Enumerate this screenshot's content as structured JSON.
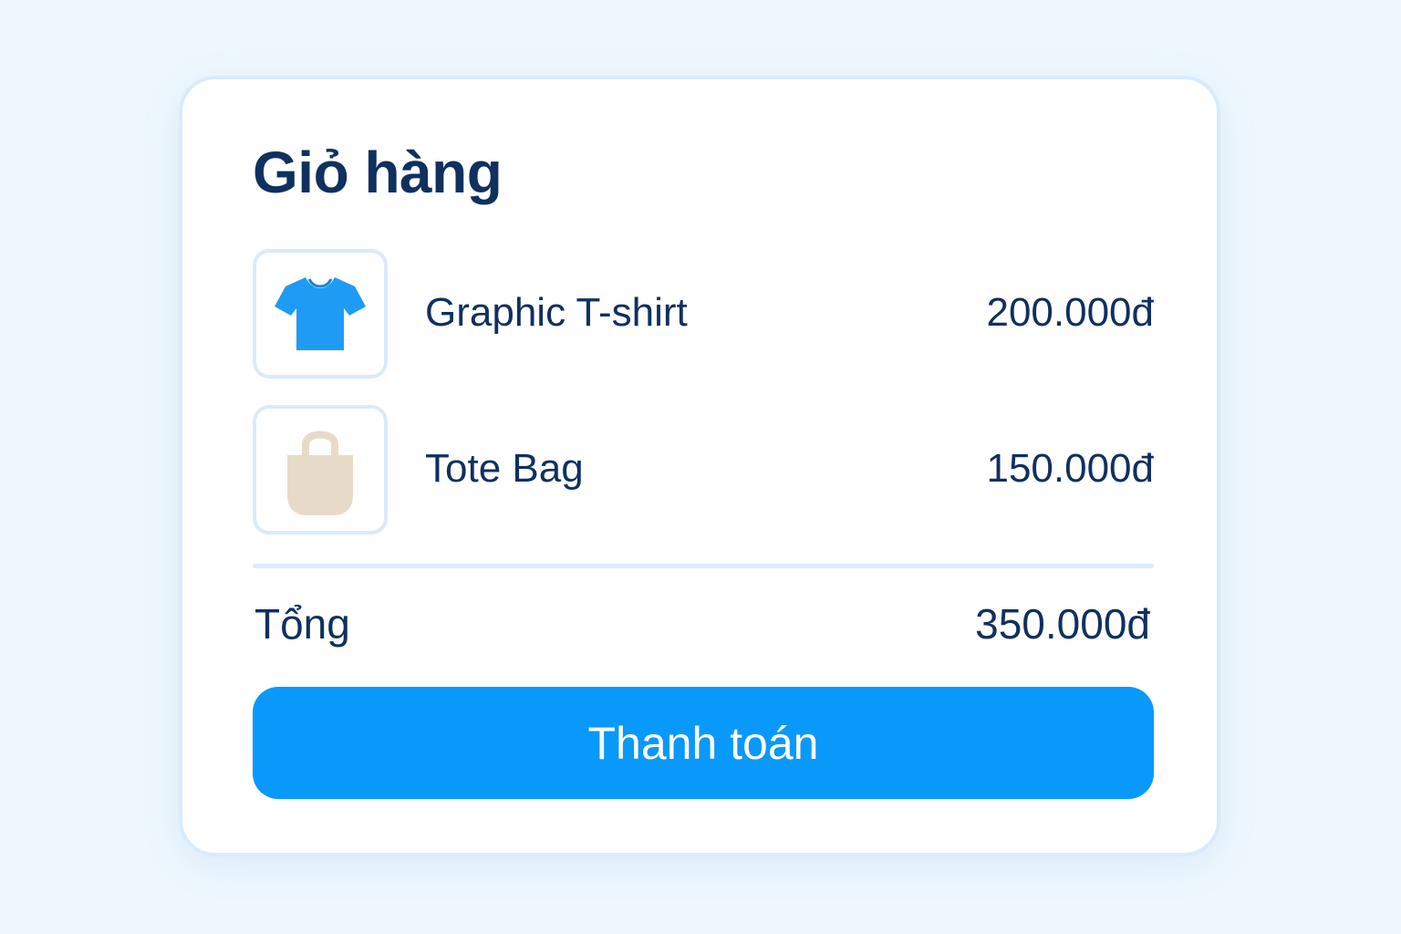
{
  "cart": {
    "title": "Giỏ hàng",
    "items": [
      {
        "name": "Graphic T-shirt",
        "price": "200.000đ",
        "icon": "tshirt-icon",
        "icon_color": "#1e9bf5"
      },
      {
        "name": "Tote Bag",
        "price": "150.000đ",
        "icon": "tote-bag-icon",
        "icon_color": "#e8dac8"
      }
    ],
    "total_label": "Tổng",
    "total_value": "350.000đ",
    "checkout_label": "Thanh toán"
  },
  "colors": {
    "background": "#eef7fd",
    "card": "#ffffff",
    "border": "#d9ebfb",
    "text": "#10305f",
    "accent": "#0899fb"
  }
}
